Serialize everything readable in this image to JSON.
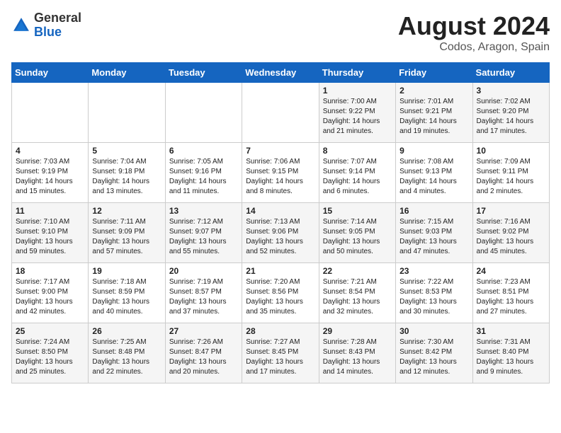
{
  "header": {
    "logo_general": "General",
    "logo_blue": "Blue",
    "title": "August 2024",
    "subtitle": "Codos, Aragon, Spain"
  },
  "weekdays": [
    "Sunday",
    "Monday",
    "Tuesday",
    "Wednesday",
    "Thursday",
    "Friday",
    "Saturday"
  ],
  "weeks": [
    [
      {
        "day": "",
        "info": ""
      },
      {
        "day": "",
        "info": ""
      },
      {
        "day": "",
        "info": ""
      },
      {
        "day": "",
        "info": ""
      },
      {
        "day": "1",
        "info": "Sunrise: 7:00 AM\nSunset: 9:22 PM\nDaylight: 14 hours\nand 21 minutes."
      },
      {
        "day": "2",
        "info": "Sunrise: 7:01 AM\nSunset: 9:21 PM\nDaylight: 14 hours\nand 19 minutes."
      },
      {
        "day": "3",
        "info": "Sunrise: 7:02 AM\nSunset: 9:20 PM\nDaylight: 14 hours\nand 17 minutes."
      }
    ],
    [
      {
        "day": "4",
        "info": "Sunrise: 7:03 AM\nSunset: 9:19 PM\nDaylight: 14 hours\nand 15 minutes."
      },
      {
        "day": "5",
        "info": "Sunrise: 7:04 AM\nSunset: 9:18 PM\nDaylight: 14 hours\nand 13 minutes."
      },
      {
        "day": "6",
        "info": "Sunrise: 7:05 AM\nSunset: 9:16 PM\nDaylight: 14 hours\nand 11 minutes."
      },
      {
        "day": "7",
        "info": "Sunrise: 7:06 AM\nSunset: 9:15 PM\nDaylight: 14 hours\nand 8 minutes."
      },
      {
        "day": "8",
        "info": "Sunrise: 7:07 AM\nSunset: 9:14 PM\nDaylight: 14 hours\nand 6 minutes."
      },
      {
        "day": "9",
        "info": "Sunrise: 7:08 AM\nSunset: 9:13 PM\nDaylight: 14 hours\nand 4 minutes."
      },
      {
        "day": "10",
        "info": "Sunrise: 7:09 AM\nSunset: 9:11 PM\nDaylight: 14 hours\nand 2 minutes."
      }
    ],
    [
      {
        "day": "11",
        "info": "Sunrise: 7:10 AM\nSunset: 9:10 PM\nDaylight: 13 hours\nand 59 minutes."
      },
      {
        "day": "12",
        "info": "Sunrise: 7:11 AM\nSunset: 9:09 PM\nDaylight: 13 hours\nand 57 minutes."
      },
      {
        "day": "13",
        "info": "Sunrise: 7:12 AM\nSunset: 9:07 PM\nDaylight: 13 hours\nand 55 minutes."
      },
      {
        "day": "14",
        "info": "Sunrise: 7:13 AM\nSunset: 9:06 PM\nDaylight: 13 hours\nand 52 minutes."
      },
      {
        "day": "15",
        "info": "Sunrise: 7:14 AM\nSunset: 9:05 PM\nDaylight: 13 hours\nand 50 minutes."
      },
      {
        "day": "16",
        "info": "Sunrise: 7:15 AM\nSunset: 9:03 PM\nDaylight: 13 hours\nand 47 minutes."
      },
      {
        "day": "17",
        "info": "Sunrise: 7:16 AM\nSunset: 9:02 PM\nDaylight: 13 hours\nand 45 minutes."
      }
    ],
    [
      {
        "day": "18",
        "info": "Sunrise: 7:17 AM\nSunset: 9:00 PM\nDaylight: 13 hours\nand 42 minutes."
      },
      {
        "day": "19",
        "info": "Sunrise: 7:18 AM\nSunset: 8:59 PM\nDaylight: 13 hours\nand 40 minutes."
      },
      {
        "day": "20",
        "info": "Sunrise: 7:19 AM\nSunset: 8:57 PM\nDaylight: 13 hours\nand 37 minutes."
      },
      {
        "day": "21",
        "info": "Sunrise: 7:20 AM\nSunset: 8:56 PM\nDaylight: 13 hours\nand 35 minutes."
      },
      {
        "day": "22",
        "info": "Sunrise: 7:21 AM\nSunset: 8:54 PM\nDaylight: 13 hours\nand 32 minutes."
      },
      {
        "day": "23",
        "info": "Sunrise: 7:22 AM\nSunset: 8:53 PM\nDaylight: 13 hours\nand 30 minutes."
      },
      {
        "day": "24",
        "info": "Sunrise: 7:23 AM\nSunset: 8:51 PM\nDaylight: 13 hours\nand 27 minutes."
      }
    ],
    [
      {
        "day": "25",
        "info": "Sunrise: 7:24 AM\nSunset: 8:50 PM\nDaylight: 13 hours\nand 25 minutes."
      },
      {
        "day": "26",
        "info": "Sunrise: 7:25 AM\nSunset: 8:48 PM\nDaylight: 13 hours\nand 22 minutes."
      },
      {
        "day": "27",
        "info": "Sunrise: 7:26 AM\nSunset: 8:47 PM\nDaylight: 13 hours\nand 20 minutes."
      },
      {
        "day": "28",
        "info": "Sunrise: 7:27 AM\nSunset: 8:45 PM\nDaylight: 13 hours\nand 17 minutes."
      },
      {
        "day": "29",
        "info": "Sunrise: 7:28 AM\nSunset: 8:43 PM\nDaylight: 13 hours\nand 14 minutes."
      },
      {
        "day": "30",
        "info": "Sunrise: 7:30 AM\nSunset: 8:42 PM\nDaylight: 13 hours\nand 12 minutes."
      },
      {
        "day": "31",
        "info": "Sunrise: 7:31 AM\nSunset: 8:40 PM\nDaylight: 13 hours\nand 9 minutes."
      }
    ]
  ]
}
